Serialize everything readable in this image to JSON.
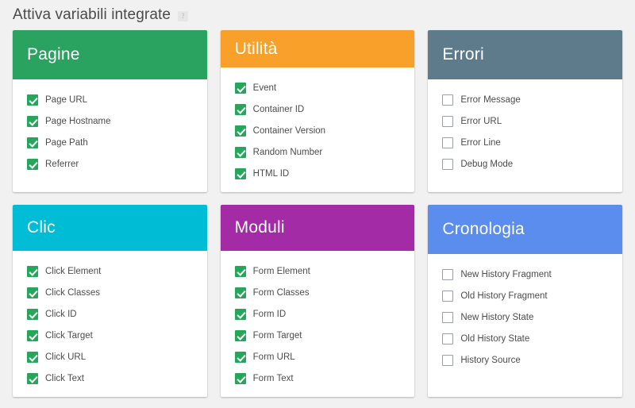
{
  "header": {
    "title": "Attiva variabili integrate",
    "help_icon": "help-icon",
    "help_glyph": "?"
  },
  "colors": {
    "page_background": "#f1f1f1",
    "card_background": "#ffffff",
    "checkbox_checked": "#26a65b",
    "checkbox_unchecked_border": "#9aa0a6",
    "pagine": "#2ba360",
    "utilita": "#f9a02a",
    "errori": "#5d7b8a",
    "clic": "#00bcd4",
    "moduli": "#a32ba6",
    "cronologia": "#5b8def"
  },
  "cards": [
    {
      "id": "pagine",
      "title": "Pagine",
      "header_color": "#2ba360",
      "items": [
        {
          "label": "Page URL",
          "checked": true
        },
        {
          "label": "Page Hostname",
          "checked": true
        },
        {
          "label": "Page Path",
          "checked": true
        },
        {
          "label": "Referrer",
          "checked": true
        }
      ]
    },
    {
      "id": "utilita",
      "title": "Utilità",
      "header_color": "#f9a02a",
      "items": [
        {
          "label": "Event",
          "checked": true
        },
        {
          "label": "Container ID",
          "checked": true
        },
        {
          "label": "Container Version",
          "checked": true
        },
        {
          "label": "Random Number",
          "checked": true
        },
        {
          "label": "HTML ID",
          "checked": true
        }
      ]
    },
    {
      "id": "errori",
      "title": "Errori",
      "header_color": "#5d7b8a",
      "items": [
        {
          "label": "Error Message",
          "checked": false
        },
        {
          "label": "Error URL",
          "checked": false
        },
        {
          "label": "Error Line",
          "checked": false
        },
        {
          "label": "Debug Mode",
          "checked": false
        }
      ]
    },
    {
      "id": "clic",
      "title": "Clic",
      "header_color": "#00bcd4",
      "items": [
        {
          "label": "Click Element",
          "checked": true
        },
        {
          "label": "Click Classes",
          "checked": true
        },
        {
          "label": "Click ID",
          "checked": true
        },
        {
          "label": "Click Target",
          "checked": true
        },
        {
          "label": "Click URL",
          "checked": true
        },
        {
          "label": "Click Text",
          "checked": true
        }
      ]
    },
    {
      "id": "moduli",
      "title": "Moduli",
      "header_color": "#a32ba6",
      "items": [
        {
          "label": "Form Element",
          "checked": true
        },
        {
          "label": "Form Classes",
          "checked": true
        },
        {
          "label": "Form ID",
          "checked": true
        },
        {
          "label": "Form Target",
          "checked": true
        },
        {
          "label": "Form URL",
          "checked": true
        },
        {
          "label": "Form Text",
          "checked": true
        }
      ]
    },
    {
      "id": "cronologia",
      "title": "Cronologia",
      "header_color": "#5b8def",
      "items": [
        {
          "label": "New History Fragment",
          "checked": false
        },
        {
          "label": "Old History Fragment",
          "checked": false
        },
        {
          "label": "New History State",
          "checked": false
        },
        {
          "label": "Old History State",
          "checked": false
        },
        {
          "label": "History Source",
          "checked": false
        }
      ]
    }
  ]
}
